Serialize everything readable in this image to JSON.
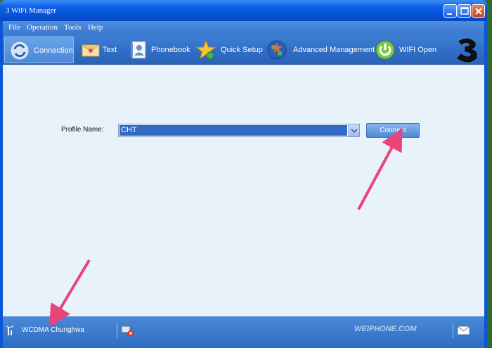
{
  "window": {
    "title": "3 WiFi Manager"
  },
  "menu": [
    {
      "label": "File"
    },
    {
      "label": "Operation"
    },
    {
      "label": "Tools"
    },
    {
      "label": "Help"
    }
  ],
  "toolbar": [
    {
      "label": "Connection",
      "icon": "connection-icon",
      "active": true
    },
    {
      "label": "Text",
      "icon": "envelope-icon"
    },
    {
      "label": "Phonebook",
      "icon": "phonebook-icon"
    },
    {
      "label": "Quick Setup",
      "icon": "star-icon"
    },
    {
      "label": "Advanced Management",
      "icon": "globe-icon"
    },
    {
      "label": "WIFI Open",
      "icon": "power-icon"
    }
  ],
  "brand": {
    "logo": "3"
  },
  "profile": {
    "label": "Profile Name:",
    "value": "CHT",
    "connect_label": "Connect"
  },
  "status": {
    "network": "WCDMA  Chunghwa",
    "watermark": "WEIPHONE.COM"
  },
  "colors": {
    "titlebar": "#0a55d8",
    "client_bg": "#e8f2fb",
    "selection": "#316ac5",
    "annotation_arrow": "#e8457a"
  }
}
